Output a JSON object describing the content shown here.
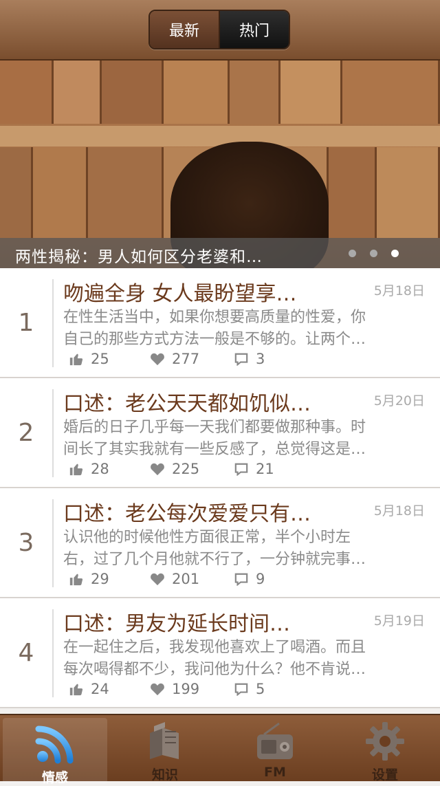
{
  "header": {
    "segments": [
      {
        "label": "最新",
        "selected": false
      },
      {
        "label": "热门",
        "selected": true
      }
    ]
  },
  "banner": {
    "caption": "两性揭秘：男人如何区分老婆和…",
    "page_count": 3,
    "active_page": 3
  },
  "articles": [
    {
      "rank": "1",
      "title": "吻遍全身 女人最盼望享…",
      "date": "5月18日",
      "desc_line1": "在性生活当中，如果你想要高质量的性爱，你",
      "desc_line2": "自己的那些方式方法一般是不够的。让两个…",
      "likes": "25",
      "favorites": "277",
      "comments": "3"
    },
    {
      "rank": "2",
      "title": "口述：老公天天都如饥似…",
      "date": "5月20日",
      "desc_line1": "婚后的日子几乎每一天我们都要做那种事。时",
      "desc_line2": "间长了其实我就有一些反感了，总觉得这是…",
      "likes": "28",
      "favorites": "225",
      "comments": "21"
    },
    {
      "rank": "3",
      "title": "口述：老公每次爱爱只有…",
      "date": "5月18日",
      "desc_line1": "认识他的时候他性方面很正常，半个小时左",
      "desc_line2": "右，过了几个月他就不行了，一分钟就完事…",
      "likes": "29",
      "favorites": "201",
      "comments": "9"
    },
    {
      "rank": "4",
      "title": "口述：男友为延长时间…",
      "date": "5月19日",
      "desc_line1": "在一起住之后，我发现他喜欢上了喝酒。而且",
      "desc_line2": "每次喝得都不少，我问他为什么？他不肯说…",
      "likes": "24",
      "favorites": "199",
      "comments": "5"
    }
  ],
  "tabbar": {
    "tabs": [
      {
        "label": "情感",
        "icon": "rss-feed-icon",
        "active": true
      },
      {
        "label": "知识",
        "icon": "books-icon",
        "active": false
      },
      {
        "label": "FM",
        "icon": "radio-icon",
        "active": false
      },
      {
        "label": "设置",
        "icon": "gear-icon",
        "active": false
      }
    ]
  },
  "colors": {
    "brand_brown": "#7a4e2e",
    "title_brown": "#6b3a1d",
    "feed_blue": "#3aa0e8"
  }
}
